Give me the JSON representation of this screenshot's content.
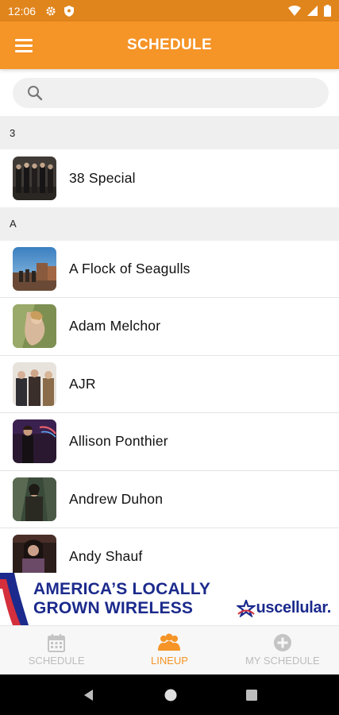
{
  "status_bar": {
    "time": "12:06"
  },
  "header": {
    "title": "SCHEDULE"
  },
  "search": {
    "placeholder": ""
  },
  "sections": [
    {
      "letter": "3",
      "artists": [
        "38 Special"
      ]
    },
    {
      "letter": "A",
      "artists": [
        "A Flock of Seagulls",
        "Adam Melchor",
        "AJR",
        "Allison Ponthier",
        "Andrew Duhon",
        "Andy Shauf"
      ]
    }
  ],
  "ad": {
    "line1": "AMERICA’S LOCALLY",
    "line2": "GROWN WIRELESS",
    "brand": "uscellular."
  },
  "tabs": [
    {
      "label": "SCHEDULE",
      "icon": "calendar-icon",
      "active": false
    },
    {
      "label": "LINEUP",
      "icon": "people-icon",
      "active": true
    },
    {
      "label": "MY SCHEDULE",
      "icon": "plus-circle-icon",
      "active": false
    }
  ],
  "colors": {
    "accent": "#f59427",
    "status_bar": "#e0841c",
    "ad_blue": "#1b2a8c",
    "ad_red": "#d32f3c",
    "inactive_tab": "#bdbdbd"
  }
}
